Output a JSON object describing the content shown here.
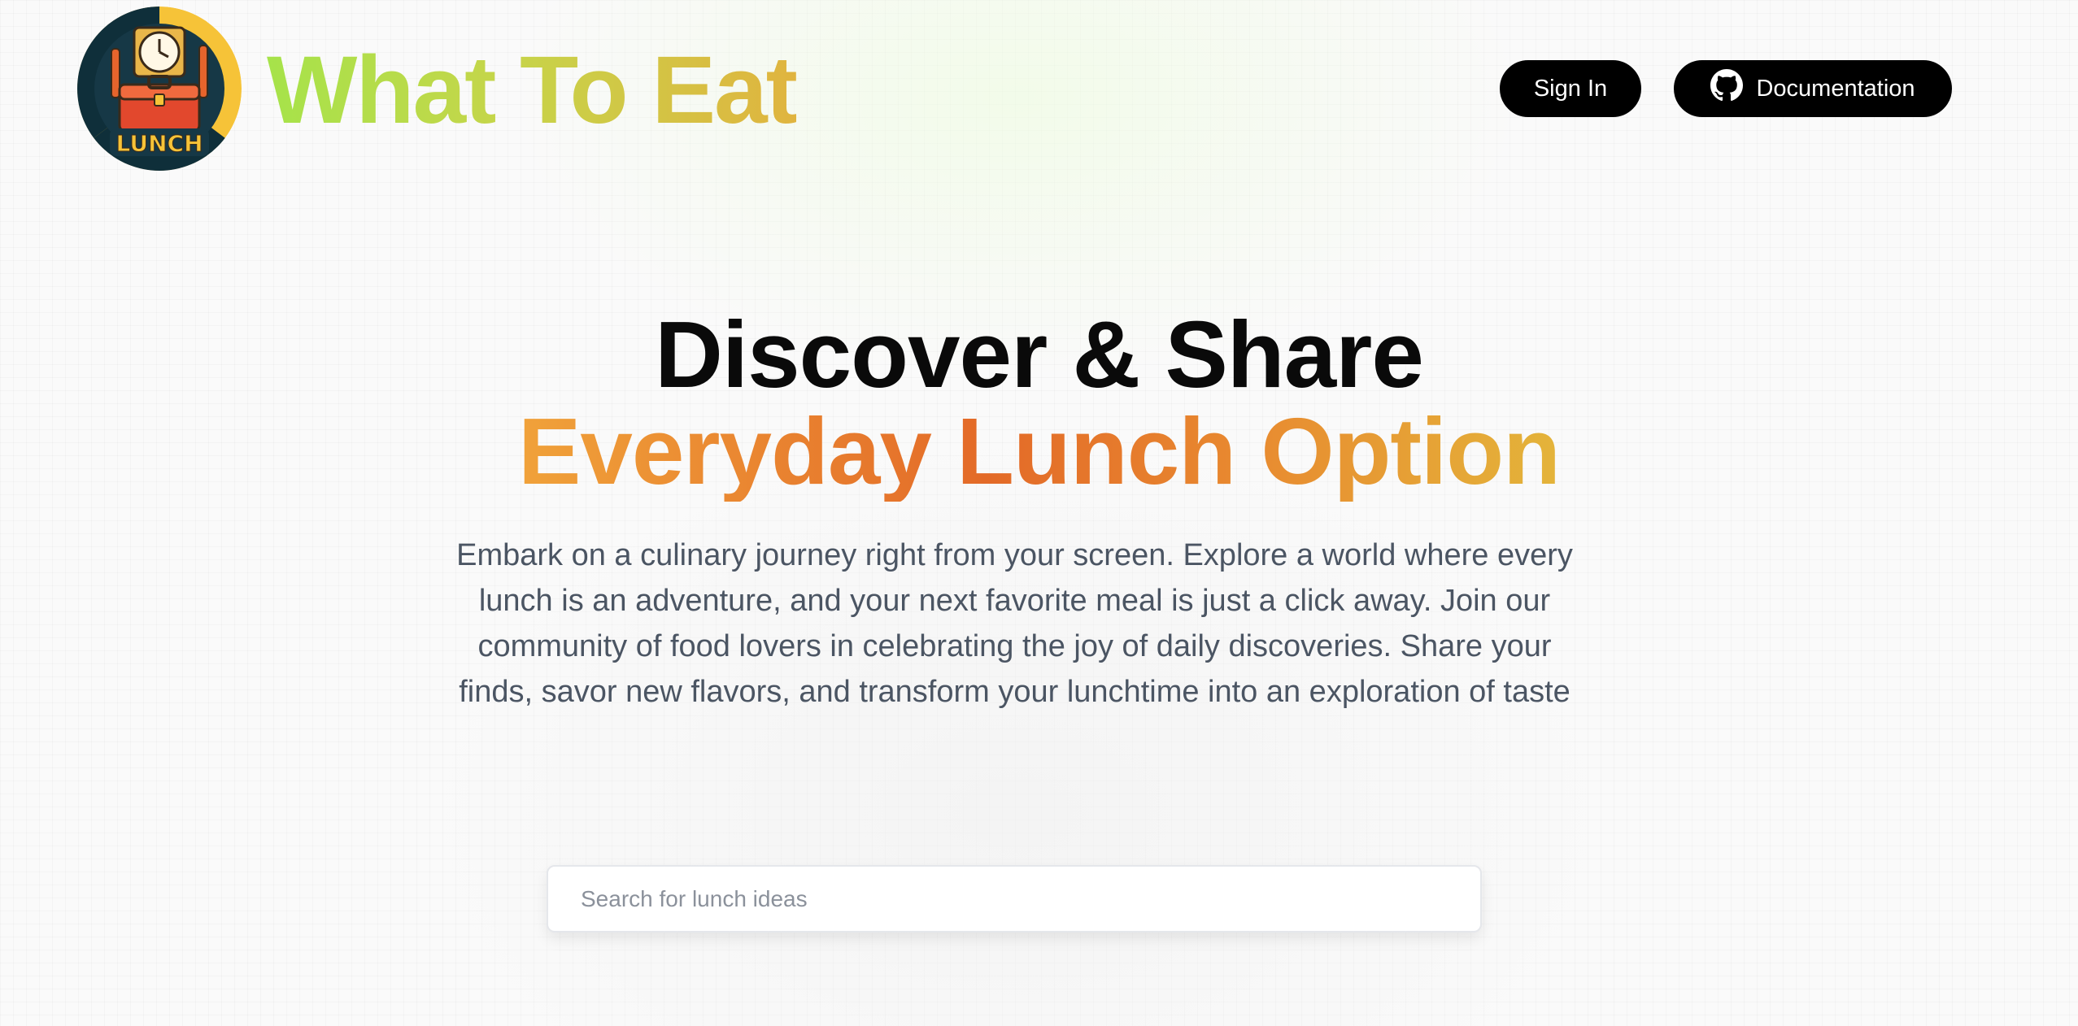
{
  "header": {
    "brand_title": "What To Eat",
    "logo_text": "LUNCH",
    "signin_label": "Sign In",
    "docs_label": "Documentation",
    "docs_icon": "github-icon"
  },
  "hero": {
    "headline_line1": "Discover & Share",
    "headline_line2": "Everyday Lunch Option",
    "description": "Embark on a culinary journey right from your screen. Explore a world where every lunch is an adventure, and your next favorite meal is just a click away. Join our community of food lovers in celebrating the joy of daily discoveries. Share your finds, savor new flavors, and transform your lunchtime into an exploration of taste"
  },
  "search": {
    "value": "",
    "placeholder": "Search for lunch ideas"
  },
  "colors": {
    "brand_gradient": [
      "#a6e34a",
      "#e0b43f"
    ],
    "headline_gradient": [
      "#f0a23a",
      "#e36a28",
      "#e4b43a"
    ],
    "button_bg": "#000000",
    "button_text": "#ffffff",
    "description_text": "#4b5563"
  }
}
